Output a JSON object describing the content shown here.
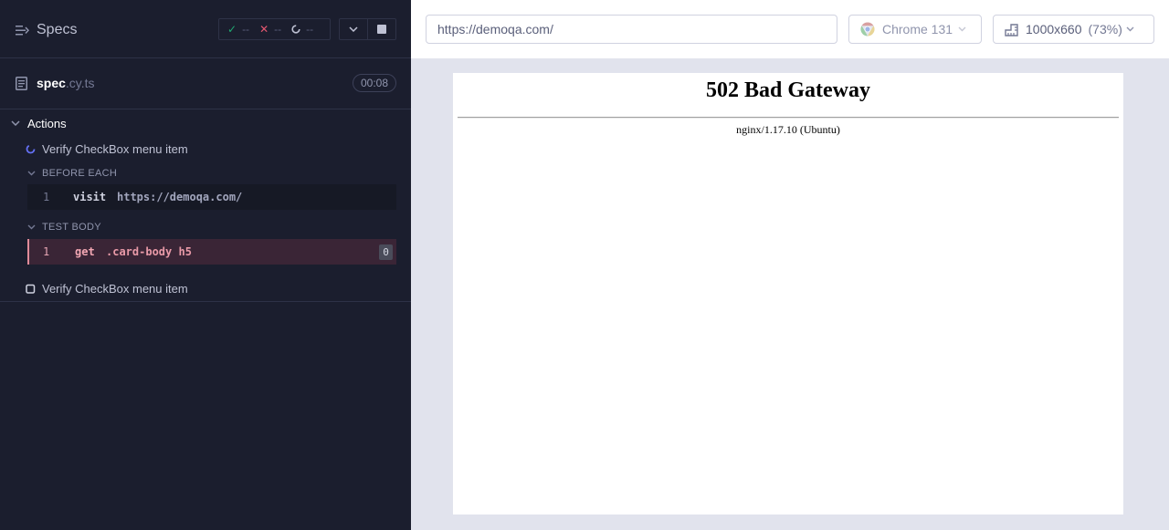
{
  "reporter": {
    "specs_label": "Specs",
    "stats": {
      "passed": "--",
      "failed": "--",
      "pending": "--"
    },
    "file": {
      "base": "spec",
      "ext": ".cy.ts"
    },
    "duration": "00:08",
    "suite": "Actions",
    "tests": [
      {
        "title": "Verify CheckBox menu item",
        "state": "running",
        "hooks": [
          {
            "label": "BEFORE EACH",
            "commands": [
              {
                "num": "1",
                "name": "visit",
                "arg": "https://demoqa.com/"
              }
            ]
          },
          {
            "label": "TEST BODY",
            "commands": [
              {
                "num": "1",
                "name": "get",
                "arg": ".card-body h5",
                "count": "0"
              }
            ]
          }
        ]
      },
      {
        "title": "Verify CheckBox menu item",
        "state": "pending"
      }
    ]
  },
  "aut": {
    "url": "https://demoqa.com/",
    "browser": "Chrome 131",
    "viewport": "1000x660",
    "scale": "(73%)",
    "page": {
      "heading": "502 Bad Gateway",
      "server": "nginx/1.17.10 (Ubuntu)"
    }
  },
  "colors": {
    "panel_bg": "#1b1e2e",
    "pass": "#1fa971",
    "fail": "#e45770",
    "failed_cmd_bg": "#3a2536"
  }
}
